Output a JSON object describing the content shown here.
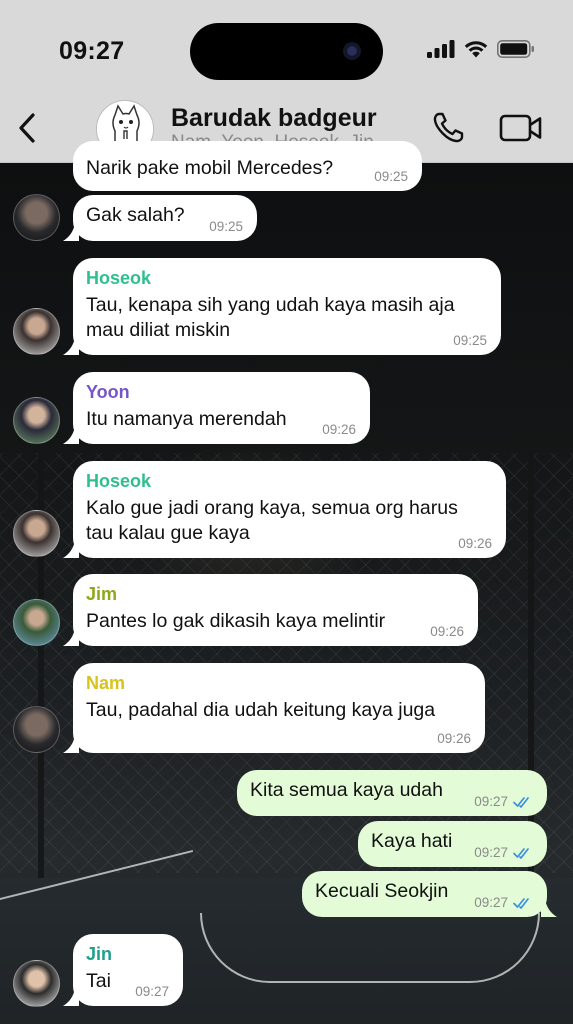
{
  "status_bar": {
    "time": "09:27"
  },
  "header": {
    "title": "Barudak badgeur",
    "subtitle": "Nam, Yoon, Hoseok, Jin..."
  },
  "messages": [
    {
      "type": "in",
      "text": "Narik pake mobil Mercedes?",
      "time": "09:25"
    },
    {
      "type": "in",
      "text": "Gak salah?",
      "time": "09:25"
    },
    {
      "type": "in",
      "sender": "Hoseok",
      "sender_color": "#2fbf8f",
      "lines": [
        "Tau, kenapa sih yang udah kaya masih aja",
        "mau diliat miskin"
      ],
      "time": "09:25"
    },
    {
      "type": "in",
      "sender": "Yoon",
      "sender_color": "#7755c9",
      "text": "Itu namanya merendah",
      "time": "09:26"
    },
    {
      "type": "in",
      "sender": "Hoseok",
      "sender_color": "#2fbf8f",
      "lines": [
        "Kalo gue jadi orang kaya, semua org harus",
        "tau kalau gue kaya"
      ],
      "time": "09:26"
    },
    {
      "type": "in",
      "sender": "Jim",
      "sender_color": "#8ca81c",
      "text": "Pantes lo gak dikasih kaya melintir",
      "time": "09:26"
    },
    {
      "type": "in",
      "sender": "Nam",
      "sender_color": "#d8c31a",
      "text": "Tau, padahal dia udah keitung kaya juga",
      "time": "09:26"
    },
    {
      "type": "out",
      "text": "Kita semua kaya udah",
      "time": "09:27"
    },
    {
      "type": "out",
      "text": "Kaya hati",
      "time": "09:27"
    },
    {
      "type": "out",
      "text": "Kecuali Seokjin",
      "time": "09:27"
    },
    {
      "type": "in",
      "sender": "Jin",
      "sender_color": "#1f9e8a",
      "text": "Tai",
      "time": "09:27"
    }
  ],
  "colors": {
    "header_bg": "#d9d9d9",
    "incoming_bubble": "#ffffff",
    "outgoing_bubble": "#e3fcd7",
    "read_ticks": "#3b8fe0"
  },
  "icons": [
    "back-chevron-icon",
    "signal-icon",
    "wifi-icon",
    "battery-icon",
    "phone-icon",
    "video-camera-icon",
    "double-check-icon"
  ]
}
